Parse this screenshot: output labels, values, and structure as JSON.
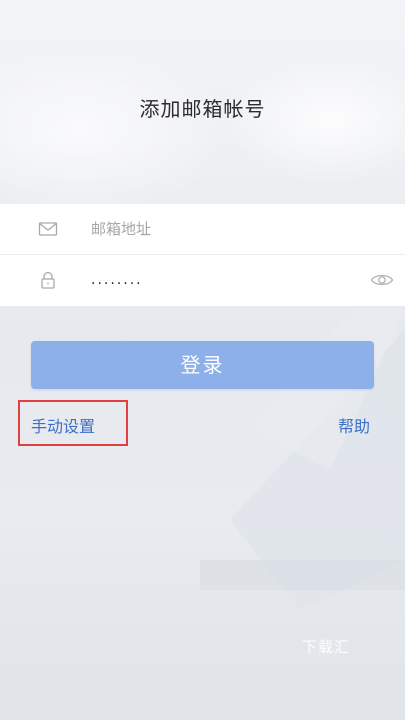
{
  "header": {
    "title": "添加邮箱帐号"
  },
  "form": {
    "email": {
      "value": "",
      "placeholder": "邮箱地址",
      "icon": "mail-icon"
    },
    "password": {
      "value": "........",
      "icon": "lock-icon",
      "toggle_icon": "eye-icon"
    }
  },
  "actions": {
    "login_label": "登录",
    "manual_setup_label": "手动设置",
    "help_label": "帮助"
  },
  "watermark": {
    "text": "下载汇"
  },
  "colors": {
    "primary_button": "#8db0ea",
    "link": "#3c6fc9",
    "highlight_box": "#e0403f"
  }
}
